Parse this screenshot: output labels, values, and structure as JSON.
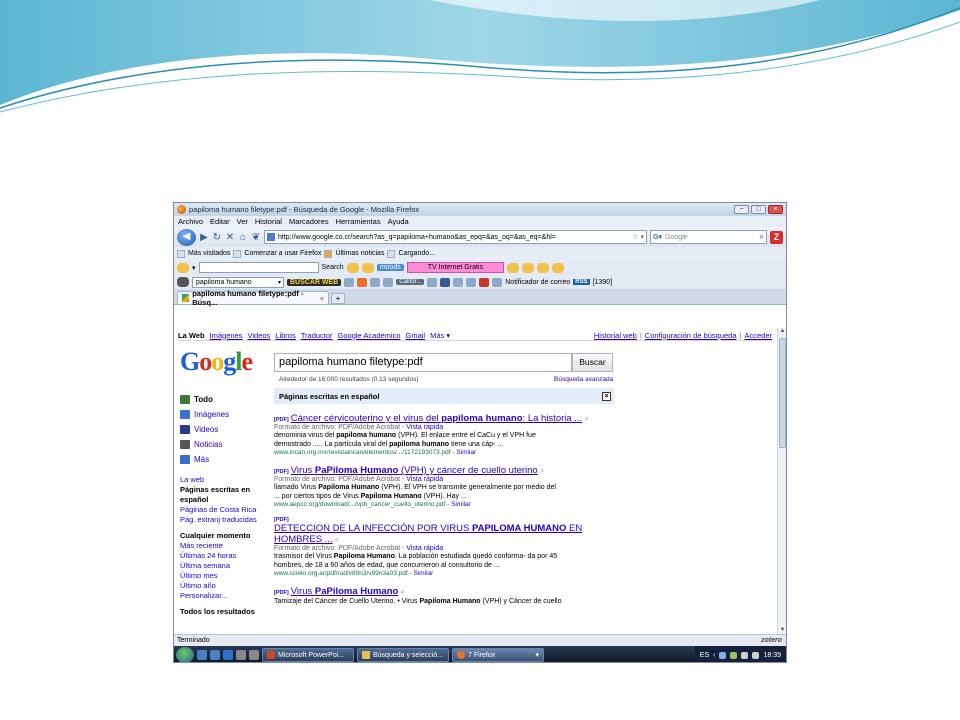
{
  "window": {
    "title": "papiloma humano filetype:pdf - Búsqueda de Google - Mozilla Firefox",
    "controls": [
      "−",
      "□",
      "×"
    ]
  },
  "menu": [
    "Archivo",
    "Editar",
    "Ver",
    "Historial",
    "Marcadores",
    "Herramientas",
    "Ayuda"
  ],
  "nav": {
    "url": "http://www.google.co.cr/search?as_q=papiloma+humano&as_epq=&as_oq=&as_eq=&hl=",
    "search_placeholder": "Google"
  },
  "bookmarks": [
    "Más visitados",
    "Comenzar a usar Firefox",
    "Últimas noticias",
    "Cargando..."
  ],
  "toolbar3": {
    "search_label": "Search",
    "mood_label": "moods",
    "tv_label": "TV Internet Gratis"
  },
  "toolbar4": {
    "dropdown_value": "papiloma humano",
    "buscar_web": "BUSCAR WEB",
    "califor": "Califor...",
    "notifier": "Notificador de correo",
    "rss": "RSS",
    "count": "[1390]"
  },
  "tab": {
    "label": "papiloma humano filetype:pdf - Búsq...",
    "new_tab": "+"
  },
  "google": {
    "nav_left": [
      "La Web",
      "Imágenes",
      "Videos",
      "Libros",
      "Traductor",
      "Google Académico",
      "Gmail",
      "Más ▾"
    ],
    "nav_right": [
      "Historial web",
      "Configuración de búsqueda",
      "Acceder"
    ],
    "query": "papiloma humano filetype:pdf",
    "search_button": "Buscar",
    "stats": "Alrededor de 16,000 resultados (0.13 segundos)",
    "advanced": "Búsqueda avanzada",
    "sidebar": {
      "main": [
        {
          "label": "Todo",
          "color": "#3b7a3b"
        },
        {
          "label": "Imágenes",
          "color": "#3a6fd0"
        },
        {
          "label": "Videos",
          "color": "#2a3a8a"
        },
        {
          "label": "Noticias",
          "color": "#555555"
        },
        {
          "label": "Más",
          "color": "#3a6fd0"
        }
      ],
      "la_web": "La web",
      "paginas_espanol": "Páginas escritas en español",
      "paginas_cr": "Páginas de Costa Rica",
      "pag_extranj": "Pág. extranj traducidas",
      "cualquier": "Cualquier momento",
      "time": [
        "Más reciente",
        "Últimas 24 horas",
        "Última semana",
        "Último mes",
        "Último año",
        "Personalizar..."
      ],
      "todos": "Todos los resultados"
    },
    "refine_label": "Páginas escritas en español",
    "results": [
      {
        "pdf": "[PDF]",
        "title_a": "Cáncer cérvicouterino y el virus del ",
        "title_b": "papiloma humano",
        "title_c": ": La historia ...",
        "format": "Formato de archivo: PDF/Adobe Acrobat - ",
        "quick": "Vista rápida",
        "snip1a": "denominia virus del ",
        "snip1b": "papiloma humano",
        "snip1c": " (VPH). El enlace entre el CaCu y el VPH fue",
        "snip2a": "demostrado ..... La partícula viral del ",
        "snip2b": "papiloma humano",
        "snip2c": " tiene una cáp- ...",
        "url": "www.incan.org.mx/revistaincan/elementos/.../1172193073.pdf - ",
        "similar": "Similar"
      },
      {
        "pdf": "[PDF]",
        "title_a": "Virus ",
        "title_b": "PaPiloma Humano",
        "title_c": " (VPH) y cáncer de cuello uterino",
        "format": "Formato de archivo: PDF/Adobe Acrobat - ",
        "quick": "Vista rápida",
        "snip1a": "llamado Virus ",
        "snip1b": "Papiloma Humano",
        "snip1c": " (VPH). El VPH se transmite generalmente por medio del",
        "snip2a": "... por ciertos tipos de Virus ",
        "snip2b": "Papiloma Humano",
        "snip2c": " (VPH). Hay ...",
        "url": "www.aepcc.org/download/.../vph_cancer_cuello_uterino.pdf - ",
        "similar": "Similar"
      },
      {
        "pdf": "[PDF]",
        "title_a": "DETECCION DE LA INFECCIÓN POR VIRUS ",
        "title_b": "PAPILOMA HUMANO",
        "title_c": " EN HOMBRES ...",
        "format": "Formato de archivo: PDF/Adobe Acrobat - ",
        "quick": "Vista rápida",
        "snip1a": "trasmisor del Virus ",
        "snip1b": "Papiloma Humano",
        "snip1c": ". La población estudiada quedó conforma- da por 45",
        "snip2a": "hombres, de 18 a 60 años de edad, que concurrieron al consultorio de ...",
        "snip2b": "",
        "snip2c": "",
        "url": "www.scielo.org.ar/pdf/rad/v89n3/v89n3a03.pdf - ",
        "similar": "Similar"
      },
      {
        "pdf": "[PDF]",
        "title_a": "Virus ",
        "title_b": "PaPiloma Humano",
        "title_c": "",
        "format": "",
        "quick": "",
        "snip1a": "Tamizaje del Cáncer de Cuello Uterino. • Virus ",
        "snip1b": "Papiloma Humano",
        "snip1c": " (VPH) y Cáncer de cuello",
        "snip2a": "",
        "snip2b": "",
        "snip2c": "",
        "url": "",
        "similar": ""
      }
    ]
  },
  "status": {
    "text": "Terminado",
    "zotero": "zotero"
  },
  "taskbar": {
    "buttons": [
      "Microsoft PowerPoi...",
      "Búsqueda y selecció...",
      "7 Firefox"
    ],
    "lang": "ES",
    "time": "18:39"
  },
  "colors": {
    "accent": "#2200cc",
    "url_green": "#0e774a",
    "refine_bg": "#e5ecf9"
  }
}
